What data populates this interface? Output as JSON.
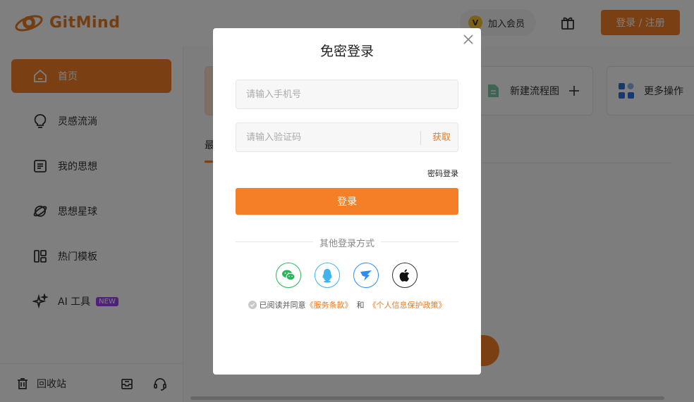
{
  "app": {
    "logo_text": "GitMind",
    "vip_label": "加入会员",
    "vip_badge": "V",
    "login_register": "登录 / 注册"
  },
  "sidebar": {
    "items": [
      {
        "label": "首页",
        "icon": "home-icon",
        "active": true
      },
      {
        "label": "灵感流淌",
        "icon": "lightbulb-icon",
        "active": false
      },
      {
        "label": "我的思想",
        "icon": "document-icon",
        "active": false
      },
      {
        "label": "思想星球",
        "icon": "planet-icon",
        "active": false
      },
      {
        "label": "热门模板",
        "icon": "template-icon",
        "active": false
      },
      {
        "label": "AI 工具",
        "icon": "sparkle-icon",
        "active": false,
        "badge": "NEW"
      }
    ],
    "trash": "回收站"
  },
  "main": {
    "cards": [
      {
        "label": "新建流程图",
        "icon": "flowchart-icon"
      },
      {
        "label": "更多操作",
        "icon": "grid-icon"
      }
    ],
    "tab_stub": "最"
  },
  "modal": {
    "title": "免密登录",
    "phone_placeholder": "请输入手机号",
    "code_placeholder": "请输入验证码",
    "get_code": "获取",
    "password_login": "密码登录",
    "submit": "登录",
    "other_methods": "其他登录方式",
    "social": [
      "wechat-icon",
      "qq-icon",
      "dingtalk-icon",
      "apple-icon"
    ],
    "agree_prefix": "已阅读并同意",
    "terms": "《服务条款》",
    "and": "和",
    "privacy": "《个人信息保护政策》"
  },
  "colors": {
    "accent": "#f47f26",
    "overlay": "rgba(0,0,0,0.5)"
  }
}
